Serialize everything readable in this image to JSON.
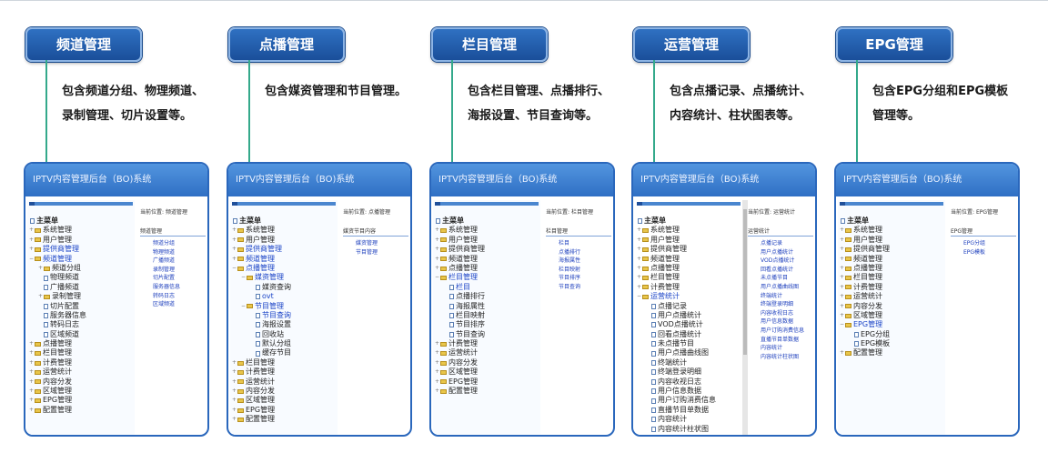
{
  "window_title": "IPTV内容管理后台（BO)系统",
  "crumb_prefix": "当前位置:",
  "panels": [
    {
      "tab": "频道管理",
      "desc": "包含频道分组、物理频道、录制管理、切片设置等。",
      "crumb": "频道管理",
      "right_title": "频道管理",
      "right_links": [
        "频道分组",
        "物理频道",
        "广播频道",
        "录制管理",
        "切片配置",
        "服务器信息",
        "转码日志",
        "区域频道"
      ],
      "tree": [
        {
          "t": "主菜单",
          "lv": 0,
          "k": "root"
        },
        {
          "t": "系统管理",
          "lv": 0,
          "k": "f",
          "ex": "+"
        },
        {
          "t": "用户管理",
          "lv": 0,
          "k": "f",
          "ex": "+"
        },
        {
          "t": "提供商管理",
          "lv": 0,
          "k": "f",
          "ex": "+",
          "sel": true
        },
        {
          "t": "频道管理",
          "lv": 0,
          "k": "f",
          "ex": "-",
          "sel": true
        },
        {
          "t": "频道分组",
          "lv": 1,
          "k": "f",
          "ex": "+"
        },
        {
          "t": "物理频道",
          "lv": 1,
          "k": "d"
        },
        {
          "t": "广播频道",
          "lv": 1,
          "k": "d"
        },
        {
          "t": "录制管理",
          "lv": 1,
          "k": "f",
          "ex": "+"
        },
        {
          "t": "切片配置",
          "lv": 1,
          "k": "d"
        },
        {
          "t": "服务器信息",
          "lv": 1,
          "k": "d"
        },
        {
          "t": "转码日志",
          "lv": 1,
          "k": "d"
        },
        {
          "t": "区域频道",
          "lv": 1,
          "k": "d"
        },
        {
          "t": "点播管理",
          "lv": 0,
          "k": "f",
          "ex": "+"
        },
        {
          "t": "栏目管理",
          "lv": 0,
          "k": "f",
          "ex": "+"
        },
        {
          "t": "计费管理",
          "lv": 0,
          "k": "f",
          "ex": "+"
        },
        {
          "t": "运营统计",
          "lv": 0,
          "k": "f",
          "ex": "+"
        },
        {
          "t": "内容分发",
          "lv": 0,
          "k": "f",
          "ex": "+"
        },
        {
          "t": "区域管理",
          "lv": 0,
          "k": "f",
          "ex": "+"
        },
        {
          "t": "EPG管理",
          "lv": 0,
          "k": "f",
          "ex": "+"
        },
        {
          "t": "配置管理",
          "lv": 0,
          "k": "f",
          "ex": "+"
        }
      ]
    },
    {
      "tab": "点播管理",
      "desc": "包含媒资管理和节目管理。",
      "crumb": "点播管理",
      "right_title": "媒资节目内容",
      "right_links": [
        "媒资管理",
        "节目管理"
      ],
      "tree": [
        {
          "t": "主菜单",
          "lv": 0,
          "k": "root"
        },
        {
          "t": "系统管理",
          "lv": 0,
          "k": "f",
          "ex": "+"
        },
        {
          "t": "用户管理",
          "lv": 0,
          "k": "f",
          "ex": "+"
        },
        {
          "t": "提供商管理",
          "lv": 0,
          "k": "f",
          "ex": "+",
          "sel": true
        },
        {
          "t": "频道管理",
          "lv": 0,
          "k": "f",
          "ex": "+",
          "sel": true
        },
        {
          "t": "点播管理",
          "lv": 0,
          "k": "f",
          "ex": "-",
          "sel": true
        },
        {
          "t": "媒资管理",
          "lv": 1,
          "k": "f",
          "ex": "-",
          "sel": true
        },
        {
          "t": "媒资查询",
          "lv": 2,
          "k": "d"
        },
        {
          "t": "ovt",
          "lv": 2,
          "k": "d",
          "sel": true
        },
        {
          "t": "节目管理",
          "lv": 1,
          "k": "f",
          "ex": "-",
          "sel": true
        },
        {
          "t": "节目查询",
          "lv": 2,
          "k": "d",
          "sel": true
        },
        {
          "t": "海报设置",
          "lv": 2,
          "k": "d"
        },
        {
          "t": "回收站",
          "lv": 2,
          "k": "d"
        },
        {
          "t": "默认分组",
          "lv": 2,
          "k": "d"
        },
        {
          "t": "缓存节目",
          "lv": 2,
          "k": "d"
        },
        {
          "t": "栏目管理",
          "lv": 0,
          "k": "f",
          "ex": "+"
        },
        {
          "t": "计费管理",
          "lv": 0,
          "k": "f",
          "ex": "+"
        },
        {
          "t": "运营统计",
          "lv": 0,
          "k": "f",
          "ex": "+"
        },
        {
          "t": "内容分发",
          "lv": 0,
          "k": "f",
          "ex": "+"
        },
        {
          "t": "区域管理",
          "lv": 0,
          "k": "f",
          "ex": "+"
        },
        {
          "t": "EPG管理",
          "lv": 0,
          "k": "f",
          "ex": "+"
        },
        {
          "t": "配置管理",
          "lv": 0,
          "k": "f",
          "ex": "+"
        }
      ]
    },
    {
      "tab": "栏目管理",
      "desc": "包含栏目管理、点播排行、海报设置、节目查询等。",
      "crumb": "栏目管理",
      "right_title": "栏目管理",
      "right_links": [
        "栏目",
        "点播排行",
        "海报属性",
        "栏目映射",
        "节目排序",
        "节目查询"
      ],
      "tree": [
        {
          "t": "主菜单",
          "lv": 0,
          "k": "root"
        },
        {
          "t": "系统管理",
          "lv": 0,
          "k": "f",
          "ex": "+"
        },
        {
          "t": "用户管理",
          "lv": 0,
          "k": "f",
          "ex": "+"
        },
        {
          "t": "提供商管理",
          "lv": 0,
          "k": "f",
          "ex": "+"
        },
        {
          "t": "频道管理",
          "lv": 0,
          "k": "f",
          "ex": "+"
        },
        {
          "t": "点播管理",
          "lv": 0,
          "k": "f",
          "ex": "+"
        },
        {
          "t": "栏目管理",
          "lv": 0,
          "k": "f",
          "ex": "-",
          "sel": true
        },
        {
          "t": "栏目",
          "lv": 1,
          "k": "d",
          "sel": true
        },
        {
          "t": "点播排行",
          "lv": 1,
          "k": "d"
        },
        {
          "t": "海报属性",
          "lv": 1,
          "k": "d"
        },
        {
          "t": "栏目映射",
          "lv": 1,
          "k": "d"
        },
        {
          "t": "节目排序",
          "lv": 1,
          "k": "d"
        },
        {
          "t": "节目查询",
          "lv": 1,
          "k": "d"
        },
        {
          "t": "计费管理",
          "lv": 0,
          "k": "f",
          "ex": "+"
        },
        {
          "t": "运营统计",
          "lv": 0,
          "k": "f",
          "ex": "+"
        },
        {
          "t": "内容分发",
          "lv": 0,
          "k": "f",
          "ex": "+"
        },
        {
          "t": "区域管理",
          "lv": 0,
          "k": "f",
          "ex": "+"
        },
        {
          "t": "EPG管理",
          "lv": 0,
          "k": "f",
          "ex": "+"
        },
        {
          "t": "配置管理",
          "lv": 0,
          "k": "f",
          "ex": "+"
        }
      ]
    },
    {
      "tab": "运营管理",
      "desc": "包含点播记录、点播统计、内容统计、柱状图表等。",
      "crumb": "运营统计",
      "right_title": "运营统计",
      "right_links": [
        "点播记录",
        "用户点播统计",
        "VOD点播统计",
        "回看点播统计",
        "未点播节目",
        "用户点播曲线图",
        "终端统计",
        "终端登录明细",
        "内容收视日志",
        "用户信息数据",
        "用户订购消费信息",
        "直播节目单数据",
        "内容统计",
        "内容统计柱状图"
      ],
      "tree": [
        {
          "t": "主菜单",
          "lv": 0,
          "k": "root"
        },
        {
          "t": "系统管理",
          "lv": 0,
          "k": "f",
          "ex": "+"
        },
        {
          "t": "用户管理",
          "lv": 0,
          "k": "f",
          "ex": "+"
        },
        {
          "t": "提供商管理",
          "lv": 0,
          "k": "f",
          "ex": "+"
        },
        {
          "t": "频道管理",
          "lv": 0,
          "k": "f",
          "ex": "+"
        },
        {
          "t": "点播管理",
          "lv": 0,
          "k": "f",
          "ex": "+"
        },
        {
          "t": "栏目管理",
          "lv": 0,
          "k": "f",
          "ex": "+"
        },
        {
          "t": "计费管理",
          "lv": 0,
          "k": "f",
          "ex": "+"
        },
        {
          "t": "运营统计",
          "lv": 0,
          "k": "f",
          "ex": "-",
          "sel": true
        },
        {
          "t": "点播记录",
          "lv": 1,
          "k": "d"
        },
        {
          "t": "用户点播统计",
          "lv": 1,
          "k": "d"
        },
        {
          "t": "VOD点播统计",
          "lv": 1,
          "k": "d"
        },
        {
          "t": "回看点播统计",
          "lv": 1,
          "k": "d"
        },
        {
          "t": "未点播节目",
          "lv": 1,
          "k": "d"
        },
        {
          "t": "用户点播曲线图",
          "lv": 1,
          "k": "d"
        },
        {
          "t": "终端统计",
          "lv": 1,
          "k": "d"
        },
        {
          "t": "终端登录明细",
          "lv": 1,
          "k": "d"
        },
        {
          "t": "内容收视日志",
          "lv": 1,
          "k": "d"
        },
        {
          "t": "用户信息数据",
          "lv": 1,
          "k": "d"
        },
        {
          "t": "用户订购消费信息",
          "lv": 1,
          "k": "d"
        },
        {
          "t": "直播节目单数据",
          "lv": 1,
          "k": "d"
        },
        {
          "t": "内容统计",
          "lv": 1,
          "k": "d"
        },
        {
          "t": "内容统计柱状图",
          "lv": 1,
          "k": "d"
        }
      ]
    },
    {
      "tab": "EPG管理",
      "desc": "包含EPG分组和EPG模板管理等。",
      "crumb": "EPG管理",
      "right_title": "EPG管理",
      "right_links": [
        "EPG分组",
        "EPG模板"
      ],
      "tree": [
        {
          "t": "主菜单",
          "lv": 0,
          "k": "root"
        },
        {
          "t": "系统管理",
          "lv": 0,
          "k": "f",
          "ex": "+"
        },
        {
          "t": "用户管理",
          "lv": 0,
          "k": "f",
          "ex": "+"
        },
        {
          "t": "提供商管理",
          "lv": 0,
          "k": "f",
          "ex": "+"
        },
        {
          "t": "频道管理",
          "lv": 0,
          "k": "f",
          "ex": "+"
        },
        {
          "t": "点播管理",
          "lv": 0,
          "k": "f",
          "ex": "+"
        },
        {
          "t": "栏目管理",
          "lv": 0,
          "k": "f",
          "ex": "+"
        },
        {
          "t": "计费管理",
          "lv": 0,
          "k": "f",
          "ex": "+"
        },
        {
          "t": "运营统计",
          "lv": 0,
          "k": "f",
          "ex": "+"
        },
        {
          "t": "内容分发",
          "lv": 0,
          "k": "f",
          "ex": "+"
        },
        {
          "t": "区域管理",
          "lv": 0,
          "k": "f",
          "ex": "+"
        },
        {
          "t": "EPG管理",
          "lv": 0,
          "k": "f",
          "ex": "-",
          "sel": true
        },
        {
          "t": "EPG分组",
          "lv": 1,
          "k": "d"
        },
        {
          "t": "EPG模板",
          "lv": 1,
          "k": "d"
        },
        {
          "t": "配置管理",
          "lv": 0,
          "k": "f",
          "ex": "+"
        }
      ]
    }
  ]
}
